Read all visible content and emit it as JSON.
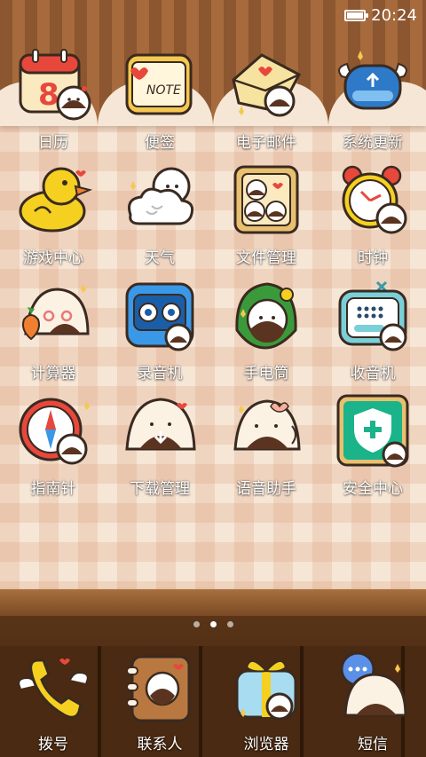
{
  "status_bar": {
    "time": "20:24",
    "battery_icon": "battery-icon"
  },
  "apps": [
    {
      "label": "日历",
      "icon": "calendar-icon",
      "accent": "#e8483c"
    },
    {
      "label": "便签",
      "icon": "note-icon",
      "accent": "#f5c850",
      "icon_text": "NOTE"
    },
    {
      "label": "电子邮件",
      "icon": "mail-icon",
      "accent": "#f7e3a0"
    },
    {
      "label": "系统更新",
      "icon": "update-icon",
      "accent": "#2e7ac8"
    },
    {
      "label": "游戏中心",
      "icon": "duck-icon",
      "accent": "#f5d020"
    },
    {
      "label": "天气",
      "icon": "cloud-icon",
      "accent": "#ffffff"
    },
    {
      "label": "文件管理",
      "icon": "folder-icon",
      "accent": "#e8c070"
    },
    {
      "label": "时钟",
      "icon": "alarm-clock-icon",
      "accent": "#e8483c"
    },
    {
      "label": "计算器",
      "icon": "calculator-icon",
      "accent": "#f08030"
    },
    {
      "label": "录音机",
      "icon": "recorder-icon",
      "accent": "#3a98e8"
    },
    {
      "label": "手电筒",
      "icon": "flashlight-icon",
      "accent": "#3a9a3a"
    },
    {
      "label": "收音机",
      "icon": "radio-icon",
      "accent": "#7ad0d8"
    },
    {
      "label": "指南针",
      "icon": "compass-icon",
      "accent": "#e8483c"
    },
    {
      "label": "下载管理",
      "icon": "download-icon",
      "accent": "#f6ecd8"
    },
    {
      "label": "语音助手",
      "icon": "voice-assistant-icon",
      "accent": "#f6ecd8"
    },
    {
      "label": "安全中心",
      "icon": "shield-icon",
      "accent": "#1ab38a"
    }
  ],
  "page_indicator": {
    "count": 3,
    "active": 1
  },
  "dock": [
    {
      "label": "拨号",
      "icon": "phone-icon",
      "accent": "#f5d020"
    },
    {
      "label": "联系人",
      "icon": "contacts-icon",
      "accent": "#b87840"
    },
    {
      "label": "浏览器",
      "icon": "gift-browser-icon",
      "accent": "#a8dcf0"
    },
    {
      "label": "短信",
      "icon": "message-bubble-icon",
      "accent": "#5a90e8"
    }
  ]
}
